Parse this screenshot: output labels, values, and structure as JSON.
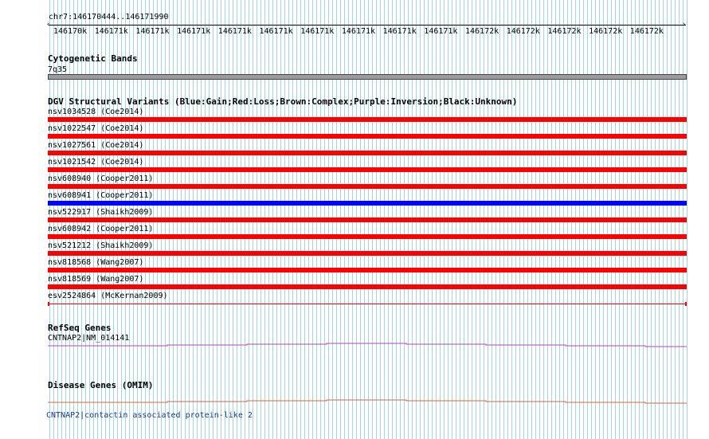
{
  "location": "chr7:146170444..146171990",
  "ruler": {
    "tick_labels": [
      "146170k",
      "146171k",
      "146171k",
      "146171k",
      "146171k",
      "146171k",
      "146171k",
      "146171k",
      "146171k",
      "146171k",
      "146172k",
      "146172k",
      "146172k",
      "146172k",
      "146172k"
    ]
  },
  "tracks": {
    "cytogenetic": {
      "title": "Cytogenetic Bands",
      "band_label": "7q35",
      "band_color": "#9b9b9b"
    },
    "dgv": {
      "title": "DGV Structural Variants (Blue:Gain;Red:Loss;Brown:Complex;Purple:Inversion;Black:Unknown)",
      "variants": [
        {
          "label": "nsv1034528 (Coe2014)",
          "type": "Loss",
          "color": "#ff0000"
        },
        {
          "label": "nsv1022547 (Coe2014)",
          "type": "Loss",
          "color": "#ff0000"
        },
        {
          "label": "nsv1027561 (Coe2014)",
          "type": "Loss",
          "color": "#ff0000"
        },
        {
          "label": "nsv1021542 (Coe2014)",
          "type": "Loss",
          "color": "#ff0000"
        },
        {
          "label": "nsv608940 (Cooper2011)",
          "type": "Loss",
          "color": "#ff0000"
        },
        {
          "label": "nsv608941 (Cooper2011)",
          "type": "Gain",
          "color": "#0000ff"
        },
        {
          "label": "nsv522917 (Shaikh2009)",
          "type": "Loss",
          "color": "#ff0000"
        },
        {
          "label": "nsv608942 (Cooper2011)",
          "type": "Loss",
          "color": "#ff0000"
        },
        {
          "label": "nsv521212 (Shaikh2009)",
          "type": "Loss",
          "color": "#ff0000"
        },
        {
          "label": "nsv818568 (Wang2007)",
          "type": "Loss",
          "color": "#ff0000"
        },
        {
          "label": "nsv818569 (Wang2007)",
          "type": "Loss",
          "color": "#ff0000"
        },
        {
          "label": "esv2524864 (McKernan2009)",
          "type": "Loss",
          "color": "#ff0000"
        }
      ]
    },
    "refseq": {
      "title": "RefSeq Genes",
      "gene_label": "CNTNAP2|NM_014141",
      "color": "#c040c0"
    },
    "omim": {
      "title": "Disease Genes (OMIM)",
      "gene_label": "CNTNAP2|contactin associated protein-like 2",
      "color": "#e06040"
    }
  },
  "colors": {
    "grid": "#9fd6e0"
  }
}
